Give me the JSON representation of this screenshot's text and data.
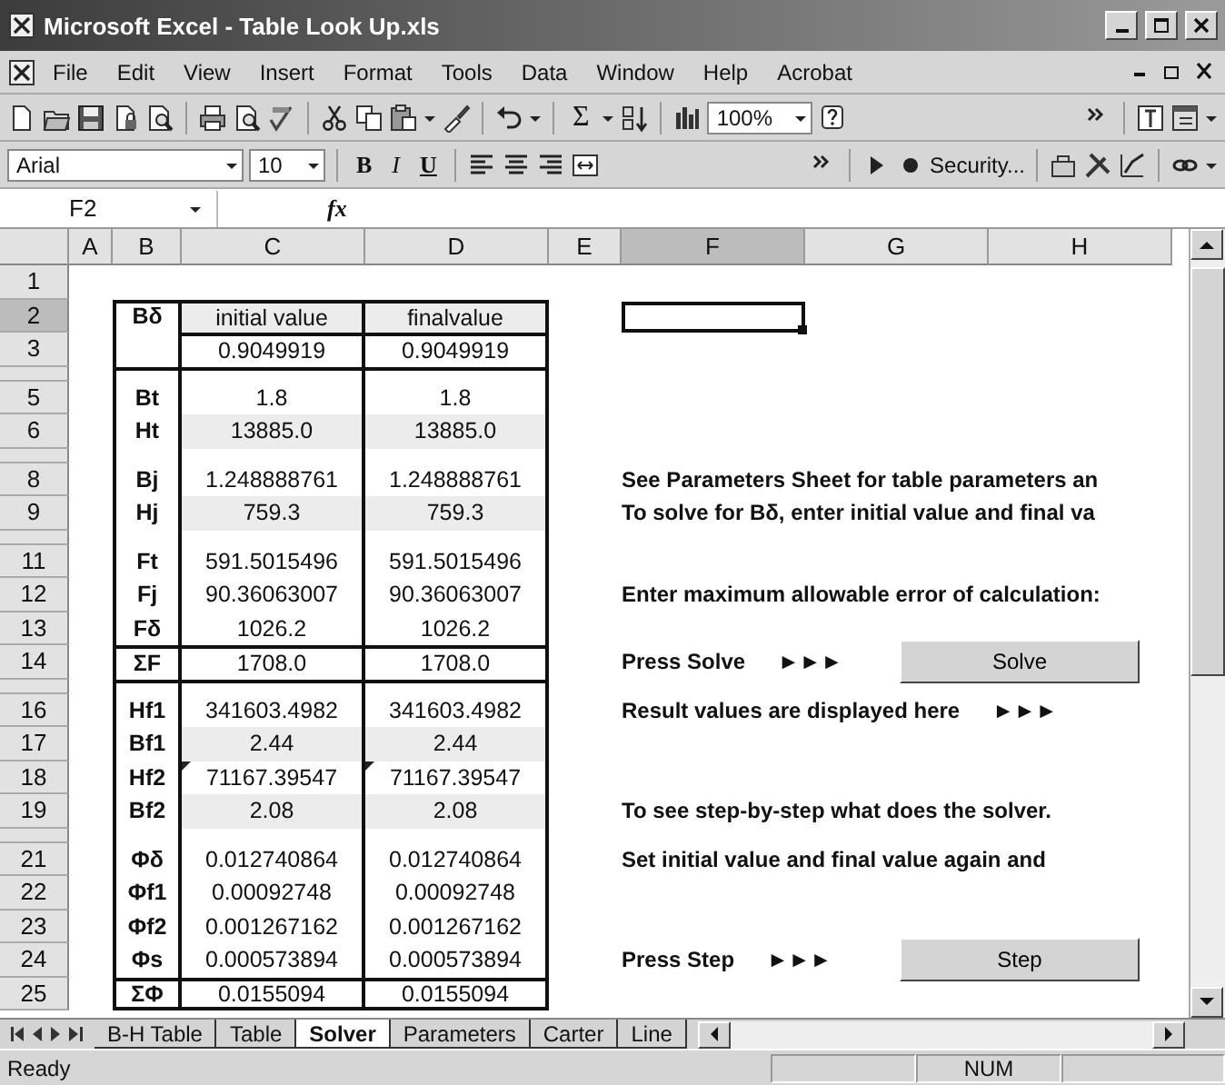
{
  "window": {
    "title": "Microsoft Excel - Table Look Up.xls"
  },
  "menu": [
    "File",
    "Edit",
    "View",
    "Insert",
    "Format",
    "Tools",
    "Data",
    "Window",
    "Help",
    "Acrobat"
  ],
  "toolbar": {
    "sum": "Σ",
    "zoom": "100%"
  },
  "format_bar": {
    "font": "Arial",
    "size": "10",
    "bold": "B",
    "italic": "I",
    "underline": "U",
    "security": "Security..."
  },
  "formula_bar": {
    "name_box": "F2",
    "fx": "fx"
  },
  "sheet": {
    "columns": [
      {
        "label": "A",
        "selected": false
      },
      {
        "label": "B",
        "selected": false
      },
      {
        "label": "C",
        "selected": false
      },
      {
        "label": "D",
        "selected": false
      },
      {
        "label": "E",
        "selected": false
      },
      {
        "label": "F",
        "selected": true
      },
      {
        "label": "G",
        "selected": false
      },
      {
        "label": "H",
        "selected": false
      }
    ],
    "rows": [
      {
        "header": "1",
        "kind": "full",
        "selected": false
      },
      {
        "header": "2",
        "kind": "full",
        "selected": true,
        "rule_above": true,
        "table": {
          "label": "Bδ",
          "initial": "initial value",
          "final": "finalvalue",
          "shaded": true,
          "flagged": false
        }
      },
      {
        "header": "3",
        "kind": "full",
        "selected": false,
        "rule_above": true,
        "table": {
          "initial": "0.9049919",
          "final": "0.9049919",
          "shaded": false,
          "flagged": false
        }
      },
      {
        "kind": "thin",
        "selected": false,
        "rule_above": true
      },
      {
        "header": "5",
        "kind": "full",
        "selected": false,
        "rule_above": false,
        "table": {
          "label": "Bt",
          "initial": "1.8",
          "final": "1.8",
          "shaded": false,
          "flagged": false
        }
      },
      {
        "header": "6",
        "kind": "full",
        "selected": false,
        "rule_above": false,
        "table": {
          "label": "Ht",
          "initial": "13885.0",
          "final": "13885.0",
          "shaded": true,
          "flagged": false
        }
      },
      {
        "kind": "thin",
        "selected": false,
        "rule_above": false
      },
      {
        "header": "8",
        "kind": "full",
        "selected": false,
        "rule_above": false,
        "table": {
          "label": "Bj",
          "initial": "1.248888761",
          "final": "1.248888761",
          "shaded": false,
          "flagged": false
        },
        "note": {
          "kind": "text",
          "text": "See Parameters Sheet for table parameters an"
        }
      },
      {
        "header": "9",
        "kind": "full",
        "selected": false,
        "rule_above": false,
        "table": {
          "label": "Hj",
          "initial": "759.3",
          "final": "759.3",
          "shaded": true,
          "flagged": false
        },
        "note": {
          "kind": "text",
          "text": "To solve for Bδ, enter initial value and final va"
        }
      },
      {
        "kind": "thin",
        "selected": false,
        "rule_above": false
      },
      {
        "header": "11",
        "kind": "full",
        "selected": false,
        "rule_above": false,
        "table": {
          "label": "Ft",
          "initial": "591.5015496",
          "final": "591.5015496",
          "shaded": false,
          "flagged": false
        }
      },
      {
        "header": "12",
        "kind": "full",
        "selected": false,
        "rule_above": false,
        "table": {
          "label": "Fj",
          "initial": "90.36063007",
          "final": "90.36063007",
          "shaded": false,
          "flagged": false
        },
        "note": {
          "kind": "text",
          "text": "Enter maximum allowable error of calculation:"
        }
      },
      {
        "header": "13",
        "kind": "full",
        "selected": false,
        "rule_above": false,
        "table": {
          "label": "Fδ",
          "initial": "1026.2",
          "final": "1026.2",
          "shaded": false,
          "flagged": false
        }
      },
      {
        "header": "14",
        "kind": "full",
        "selected": false,
        "rule_above": true,
        "table": {
          "label": "ΣF",
          "initial": "1708.0",
          "final": "1708.0",
          "shaded": false,
          "flagged": false
        },
        "note": {
          "kind": "press",
          "text": "Press Solve",
          "arrow": "►►►",
          "button": "Solve"
        }
      },
      {
        "kind": "thin",
        "selected": false,
        "rule_above": true
      },
      {
        "header": "16",
        "kind": "full",
        "selected": false,
        "rule_above": false,
        "table": {
          "label": "Hf1",
          "initial": "341603.4982",
          "final": "341603.4982",
          "shaded": false,
          "flagged": false
        },
        "note": {
          "kind": "result",
          "text": "Result values are displayed here",
          "arrow": "►►►"
        }
      },
      {
        "header": "17",
        "kind": "full",
        "selected": false,
        "rule_above": false,
        "table": {
          "label": "Bf1",
          "initial": "2.44",
          "final": "2.44",
          "shaded": true,
          "flagged": false
        }
      },
      {
        "header": "18",
        "kind": "full",
        "selected": false,
        "rule_above": false,
        "table": {
          "label": "Hf2",
          "initial": "71167.39547",
          "final": "71167.39547",
          "shaded": false,
          "flagged": true
        }
      },
      {
        "header": "19",
        "kind": "full",
        "selected": false,
        "rule_above": false,
        "table": {
          "label": "Bf2",
          "initial": "2.08",
          "final": "2.08",
          "shaded": true,
          "flagged": false
        },
        "note": {
          "kind": "text",
          "text": "To see step-by-step what does the solver."
        }
      },
      {
        "kind": "thin",
        "selected": false,
        "rule_above": false
      },
      {
        "header": "21",
        "kind": "full",
        "selected": false,
        "rule_above": false,
        "table": {
          "label": "Φδ",
          "initial": "0.012740864",
          "final": "0.012740864",
          "shaded": false,
          "flagged": false
        },
        "note": {
          "kind": "text",
          "text": "Set initial value and final value again and"
        }
      },
      {
        "header": "22",
        "kind": "full",
        "selected": false,
        "rule_above": false,
        "table": {
          "label": "Φf1",
          "initial": "0.00092748",
          "final": "0.00092748",
          "shaded": false,
          "flagged": false
        }
      },
      {
        "header": "23",
        "kind": "full",
        "selected": false,
        "rule_above": false,
        "table": {
          "label": "Φf2",
          "initial": "0.001267162",
          "final": "0.001267162",
          "shaded": false,
          "flagged": false
        }
      },
      {
        "header": "24",
        "kind": "full",
        "selected": false,
        "rule_above": false,
        "table": {
          "label": "Φs",
          "initial": "0.000573894",
          "final": "0.000573894",
          "shaded": false,
          "flagged": false
        },
        "note": {
          "kind": "press",
          "text": "Press Step",
          "arrow": "►►►",
          "button": "Step"
        }
      },
      {
        "header": "25",
        "kind": "full",
        "selected": false,
        "rule_above": true,
        "table": {
          "label": "ΣΦ",
          "initial": "0.0155094",
          "final": "0.0155094",
          "shaded": false,
          "flagged": false
        }
      }
    ]
  },
  "sheet_tabs": [
    {
      "label": "B-H Table",
      "selected": false
    },
    {
      "label": "Table",
      "selected": false
    },
    {
      "label": "Solver",
      "selected": true
    },
    {
      "label": "Parameters",
      "selected": false
    },
    {
      "label": "Carter",
      "selected": false
    },
    {
      "label": "Line",
      "selected": false
    }
  ],
  "status_bar": {
    "mode": "Ready",
    "num": "NUM"
  }
}
